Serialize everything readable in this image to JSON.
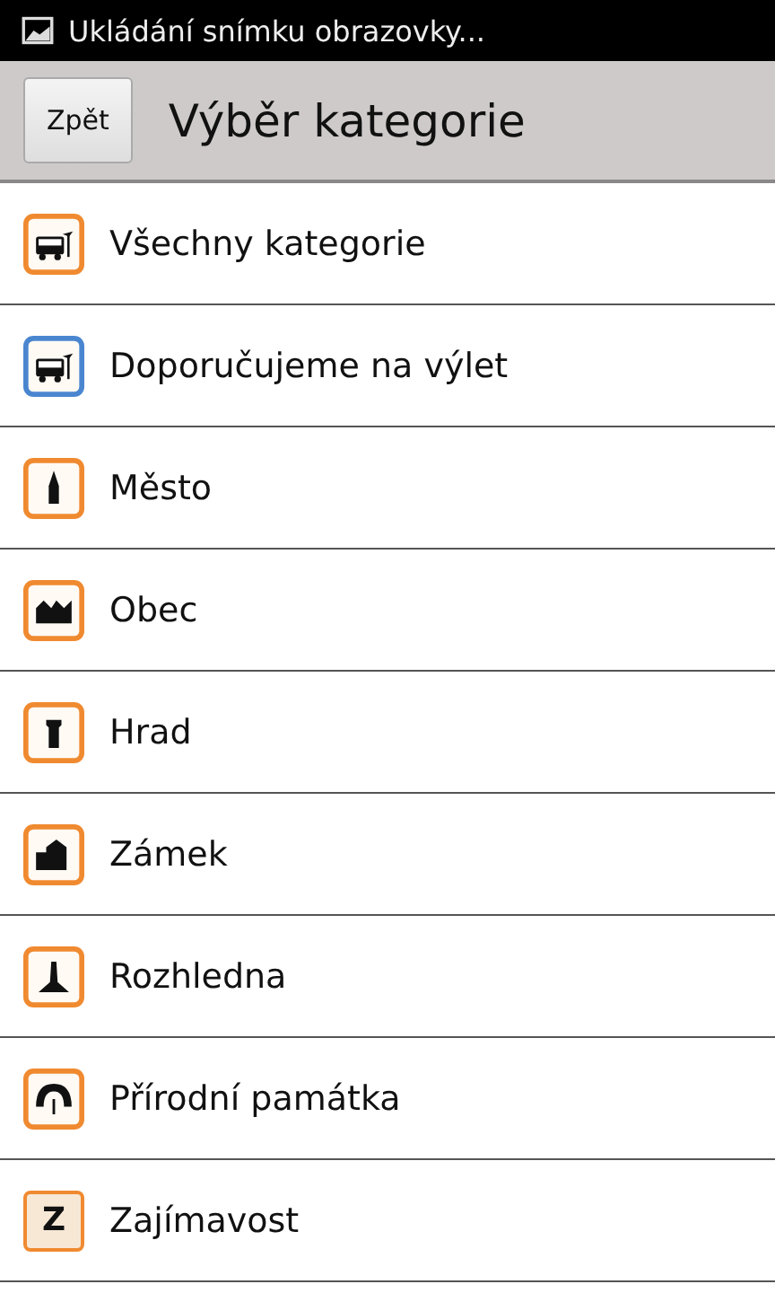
{
  "status_bar": {
    "notification": "Ukládání snímku obrazovky..."
  },
  "header": {
    "back_button": "Zpět",
    "title": "Výběr kategorie"
  },
  "categories": [
    {
      "kind": "bus",
      "color": "#f08a30",
      "label": "Všechny kategorie"
    },
    {
      "kind": "bus",
      "color": "#4a86d0",
      "label": "Doporučujeme na výlet"
    },
    {
      "kind": "church",
      "color": "#f08a30",
      "label": "Město"
    },
    {
      "kind": "houses",
      "color": "#f08a30",
      "label": "Obec"
    },
    {
      "kind": "tower",
      "color": "#f08a30",
      "label": "Hrad"
    },
    {
      "kind": "chateau",
      "color": "#f08a30",
      "label": "Zámek"
    },
    {
      "kind": "lookout",
      "color": "#f08a30",
      "label": "Rozhledna"
    },
    {
      "kind": "arch",
      "color": "#f08a30",
      "label": "Přírodní památka"
    },
    {
      "kind": "letter",
      "glyph": "Z",
      "color": "#f08a30",
      "label": "Zajímavost"
    }
  ]
}
